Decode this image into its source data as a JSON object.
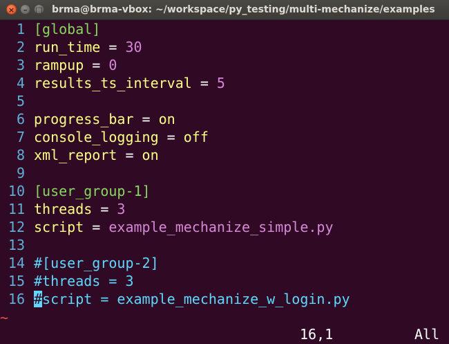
{
  "window": {
    "title": "brma@brma-vbox: ~/workspace/py_testing/multi-mechanize/examples",
    "buttons": {
      "close": "×",
      "minimize": "–",
      "maximize": "□"
    }
  },
  "editor": {
    "lines": [
      {
        "num": "1",
        "tokens": [
          {
            "t": "[global]",
            "c": "section"
          }
        ]
      },
      {
        "num": "2",
        "tokens": [
          {
            "t": "run_time",
            "c": "key"
          },
          {
            "t": " = ",
            "c": "eq"
          },
          {
            "t": "30",
            "c": "num"
          }
        ]
      },
      {
        "num": "3",
        "tokens": [
          {
            "t": "rampup",
            "c": "key"
          },
          {
            "t": " = ",
            "c": "eq"
          },
          {
            "t": "0",
            "c": "num"
          }
        ]
      },
      {
        "num": "4",
        "tokens": [
          {
            "t": "results_ts_interval",
            "c": "key"
          },
          {
            "t": " = ",
            "c": "eq"
          },
          {
            "t": "5",
            "c": "num"
          }
        ]
      },
      {
        "num": "5",
        "tokens": []
      },
      {
        "num": "6",
        "tokens": [
          {
            "t": "progress_bar",
            "c": "key"
          },
          {
            "t": " = ",
            "c": "eq"
          },
          {
            "t": "on",
            "c": "onoff"
          }
        ]
      },
      {
        "num": "7",
        "tokens": [
          {
            "t": "console_logging",
            "c": "key"
          },
          {
            "t": " = ",
            "c": "eq"
          },
          {
            "t": "off",
            "c": "onoff"
          }
        ]
      },
      {
        "num": "8",
        "tokens": [
          {
            "t": "xml_report",
            "c": "key"
          },
          {
            "t": " = ",
            "c": "eq"
          },
          {
            "t": "on",
            "c": "onoff"
          }
        ]
      },
      {
        "num": "9",
        "tokens": []
      },
      {
        "num": "10",
        "tokens": [
          {
            "t": "[user_group-1]",
            "c": "section"
          }
        ]
      },
      {
        "num": "11",
        "tokens": [
          {
            "t": "threads",
            "c": "key"
          },
          {
            "t": " = ",
            "c": "eq"
          },
          {
            "t": "3",
            "c": "num"
          }
        ]
      },
      {
        "num": "12",
        "tokens": [
          {
            "t": "script",
            "c": "key"
          },
          {
            "t": " = ",
            "c": "eq"
          },
          {
            "t": "example_mechanize_simple.py",
            "c": "str"
          }
        ]
      },
      {
        "num": "13",
        "tokens": []
      },
      {
        "num": "14",
        "tokens": [
          {
            "t": "#[user_group-2]",
            "c": "comment"
          }
        ]
      },
      {
        "num": "15",
        "tokens": [
          {
            "t": "#threads = 3",
            "c": "comment"
          }
        ]
      },
      {
        "num": "16",
        "tokens": [
          {
            "t": "#",
            "c": "cursor"
          },
          {
            "t": "script = example_mechanize_w_login.py",
            "c": "comment"
          }
        ]
      }
    ],
    "empty_line_marker": "~"
  },
  "statusline": {
    "position": "16,1",
    "scroll": "All"
  },
  "colors": {
    "background": "#300a24",
    "line_number": "#5fafd7",
    "key": "#ffff87",
    "section": "#87d75f",
    "number": "#d787d7",
    "comment": "#5fd7ff",
    "cursor": "#5fd7ff",
    "tilde": "#e05050"
  }
}
